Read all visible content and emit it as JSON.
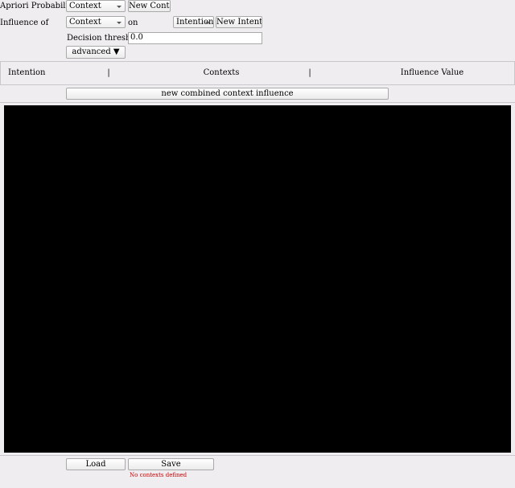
{
  "apriori": {
    "label": "Apriori Probability of",
    "context_select": "Context",
    "new_context_button": "New Context"
  },
  "influence": {
    "label": "Influence of",
    "context_select": "Context",
    "on_label": "on",
    "intention_select": "Intention",
    "new_intention_button": "New Intention"
  },
  "threshold": {
    "label": "Decision threshold :",
    "value": "0.0"
  },
  "advanced_button": "advanced ▼",
  "table": {
    "columns": [
      "Intention",
      "Contexts",
      "Influence Value"
    ],
    "separator": "|"
  },
  "combined_button": "new combined context influence",
  "footer": {
    "load_button": "Load",
    "save_button": "Save",
    "status": "No contexts defined"
  }
}
